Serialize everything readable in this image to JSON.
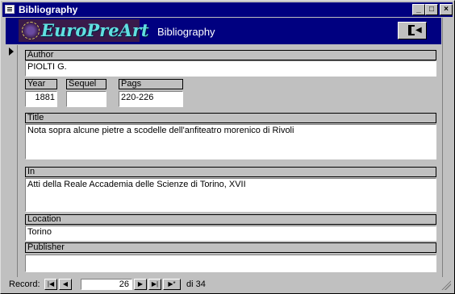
{
  "window": {
    "title": "Bibliography"
  },
  "header": {
    "logo_text": "EuroPreArt",
    "form_title": "Bibliography"
  },
  "fields": {
    "author": {
      "label": "Author",
      "value": "PIOLTI G."
    },
    "year": {
      "label": "Year",
      "value": "1881"
    },
    "sequel": {
      "label": "Sequel",
      "value": ""
    },
    "pags": {
      "label": "Pags",
      "value": "220-226"
    },
    "title": {
      "label": "Title",
      "value": "Nota sopra alcune pietre a scodelle dell'anfiteatro morenico di Rivoli"
    },
    "in": {
      "label": "In",
      "value": "Atti della Reale Accademia delle Scienze di Torino, XVII"
    },
    "location": {
      "label": "Location",
      "value": "Torino"
    },
    "publisher": {
      "label": "Publisher",
      "value": ""
    }
  },
  "navigation": {
    "label": "Record:",
    "current": "26",
    "total": "di 34"
  },
  "icons": {
    "exit": "exit-door-icon",
    "window": "form-icon"
  }
}
